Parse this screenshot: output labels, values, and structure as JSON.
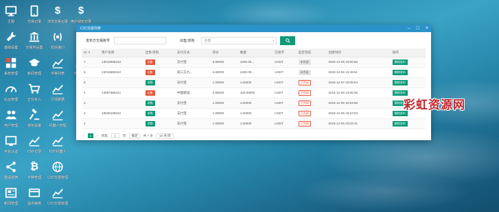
{
  "desktop_icons": [
    {
      "label": "主题",
      "icon": "monitor-icon",
      "col": 0,
      "row": 0
    },
    {
      "label": "交易记录",
      "icon": "tablet-icon",
      "col": 1,
      "row": 0
    },
    {
      "label": "法币交易记录",
      "icon": "dollar-icon",
      "col": 2,
      "row": 0
    },
    {
      "label": "用户钱包记录",
      "icon": "dollar-icon",
      "col": 3,
      "row": 0
    },
    {
      "label": "基础设置",
      "icon": "wrench-icon",
      "col": 0,
      "row": 1
    },
    {
      "label": "交易所设置",
      "icon": "bank-icon",
      "col": 1,
      "row": 1
    },
    {
      "label": "短信接口",
      "icon": "sms-icon",
      "col": 2,
      "row": 1
    },
    {
      "label": "系统管理",
      "icon": "grid-icon",
      "col": 0,
      "row": 2
    },
    {
      "label": "新闻管理",
      "icon": "graduation-icon",
      "col": 1,
      "row": 2
    },
    {
      "label": "币种列表",
      "icon": "trend-icon",
      "col": 2,
      "row": 2
    },
    {
      "label": "杠杆设置",
      "icon": "trend-icon",
      "col": 3,
      "row": 2
    },
    {
      "label": "后台管理",
      "icon": "gauge-icon",
      "col": 0,
      "row": 3
    },
    {
      "label": "正在买入",
      "icon": "cart-icon",
      "col": 1,
      "row": 3
    },
    {
      "label": "行情数据",
      "icon": "trend-icon",
      "col": 2,
      "row": 3
    },
    {
      "label": "用户管理",
      "icon": "users-icon",
      "col": 0,
      "row": 4
    },
    {
      "label": "钱包设置",
      "icon": "gavel-icon",
      "col": 1,
      "row": 4
    },
    {
      "label": "机器人管理",
      "icon": "trend-icon",
      "col": 2,
      "row": 4
    },
    {
      "label": "实名认证",
      "icon": "id-icon",
      "col": 0,
      "row": 5
    },
    {
      "label": "CNY记录",
      "icon": "trend-icon",
      "col": 1,
      "row": 5
    },
    {
      "label": "杠杆机器人",
      "icon": "trend-icon",
      "col": 2,
      "row": 5
    },
    {
      "label": "邀请返佣",
      "icon": "share-icon",
      "col": 0,
      "row": 6
    },
    {
      "label": "币种管理",
      "icon": "bitcoin-icon",
      "col": 1,
      "row": 6
    },
    {
      "label": "C2C交易管理",
      "icon": "globe-icon",
      "col": 2,
      "row": 6
    },
    {
      "label": "新闻管理",
      "icon": "news-icon",
      "col": 0,
      "row": 7
    },
    {
      "label": "提币审核",
      "icon": "card-icon",
      "col": 1,
      "row": 7
    },
    {
      "label": "C2C交易管理",
      "icon": "trend-icon",
      "col": 2,
      "row": 7
    }
  ],
  "window": {
    "title": "C2C交易列表",
    "controls": {
      "minimize": "–",
      "maximize": "□",
      "close": "×"
    },
    "filter": {
      "account_label": "发布方交易账号",
      "account_value": "",
      "type_label": "出售/求购",
      "type_value": "全部"
    },
    "table": {
      "columns": [
        "ID ⇕",
        "用户名称",
        "出售/求购",
        "支付方式",
        "单价",
        "数量",
        "交易币",
        "是否完成",
        "创建时间",
        "操作"
      ],
      "rows": [
        {
          "id": "7",
          "user": "13016868162",
          "type": "出售",
          "type_style": "red",
          "pay": "支付宝",
          "price": "6.80000",
          "amount": "1000.00...",
          "coin": "USDT",
          "done": "未完成",
          "done_style": "grey",
          "time": "2018-12-06 15:50:56",
          "op": "删除发布"
        },
        {
          "id": "6",
          "user": "13016868162",
          "type": "出售",
          "type_style": "red",
          "pay": "第三方九...",
          "price": "6.80000",
          "amount": "1000.00...",
          "coin": "USDT",
          "done": "未完成",
          "done_style": "grey",
          "time": "2018-12-06 15:49:51",
          "op": "删除发布"
        },
        {
          "id": "5",
          "user": "",
          "type": "求购",
          "type_style": "green",
          "pay": "支付宝",
          "price": "1.00000",
          "amount": "1.00000",
          "coin": "USDT",
          "done": "已完成",
          "done_style": "redo",
          "time": "2018-12-07 20:05:54",
          "op": "删除发布"
        },
        {
          "id": "4",
          "user": "13567856221",
          "type": "出售",
          "type_style": "red",
          "pay": "中国建设...",
          "price": "6.80000",
          "amount": "100.00000",
          "coin": "USDT",
          "done": "已完成",
          "done_style": "redo",
          "time": "2018-12-06 13:05:36",
          "op": "删除发布"
        },
        {
          "id": "3",
          "user": "",
          "type": "求购",
          "type_style": "green",
          "pay": "支付宝",
          "price": "1.00000",
          "amount": "1.00000",
          "coin": "USDT",
          "done": "已完成",
          "done_style": "redo",
          "time": "2018-12-06 10:53:58",
          "op": "删除发布"
        },
        {
          "id": "2",
          "user": "18636108032",
          "type": "求购",
          "type_style": "green",
          "pay": "支付宝",
          "price": "1.00000",
          "amount": "1.00000",
          "coin": "USDT",
          "done": "已完成",
          "done_style": "redo",
          "time": "2018-12-05 20:10:03",
          "op": "删除发布"
        },
        {
          "id": "1",
          "user": "",
          "type": "求购",
          "type_style": "green",
          "pay": "支付宝",
          "price": "1.00000",
          "amount": "1.00000",
          "coin": "USDT",
          "done": "已完成",
          "done_style": "redo",
          "time": "2018-12-05 20:02:31",
          "op": "删除发布"
        }
      ]
    },
    "pager": {
      "prev": "‹",
      "current": "1",
      "next": "›",
      "goto_label": "到第",
      "goto_value": "1",
      "page_unit": "页",
      "confirm": "确定",
      "total": "共 7 条",
      "per_page": "10 条/页"
    }
  },
  "watermark": "彩虹资源网",
  "colors": {
    "accent": "#0f9a77",
    "titlebar": "#2b93c9",
    "sell": "#e4553a"
  }
}
